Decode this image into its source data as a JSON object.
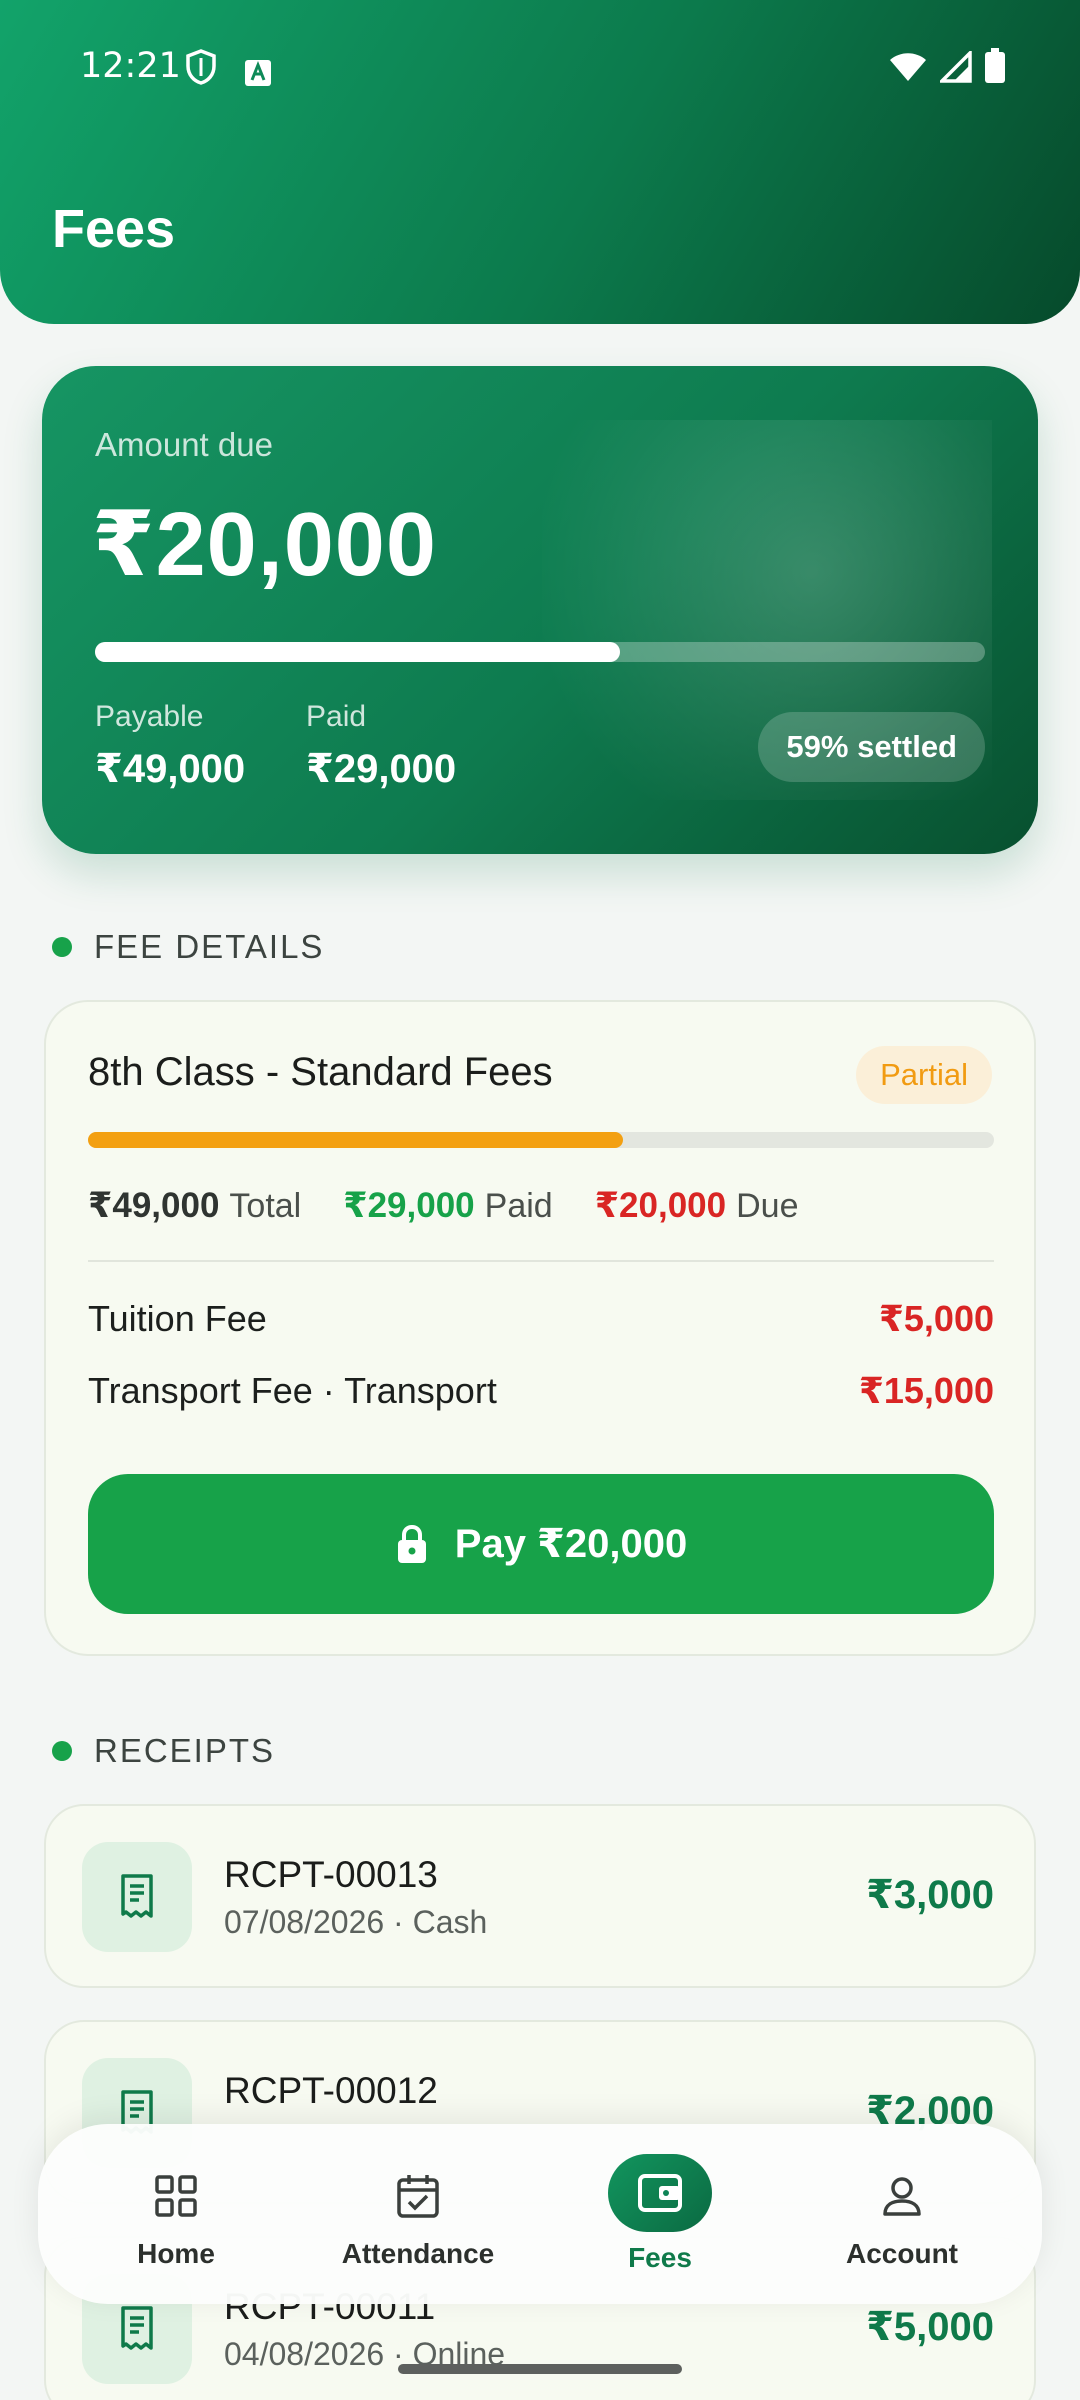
{
  "status_bar": {
    "time": "12:21"
  },
  "header": {
    "title": "Fees"
  },
  "summary": {
    "amount_label": "Amount due",
    "amount_value": "₹20,000",
    "paid_fraction": 0.59,
    "payable_label": "Payable",
    "payable_value": "₹49,000",
    "paid_label": "Paid",
    "paid_value": "₹29,000",
    "settled_text": "59% settled"
  },
  "fee_details": {
    "section_title": "FEE DETAILS",
    "class_title": "8th Class - Standard Fees",
    "status_badge": "Partial",
    "paid_fraction": 0.59,
    "total_value": "₹49,000",
    "total_label": "Total",
    "paid_value": "₹29,000",
    "paid_label": "Paid",
    "due_value": "₹20,000",
    "due_label": "Due",
    "items": [
      {
        "name": "Tuition Fee",
        "amount": "₹5,000"
      },
      {
        "name": "Transport Fee · Transport",
        "amount": "₹15,000"
      }
    ],
    "pay_label": "Pay ₹20,000"
  },
  "receipts": {
    "section_title": "RECEIPTS",
    "items": [
      {
        "number": "RCPT-00013",
        "meta": "07/08/2026 · Cash",
        "amount": "₹3,000"
      },
      {
        "number": "RCPT-00012",
        "meta": "",
        "amount": "₹2,000"
      },
      {
        "number": "RCPT-00011",
        "meta": "04/08/2026 · Online",
        "amount": "₹5,000"
      }
    ]
  },
  "nav": {
    "items": [
      {
        "label": "Home",
        "icon": "grid-icon"
      },
      {
        "label": "Attendance",
        "icon": "calendar-check-icon"
      },
      {
        "label": "Fees",
        "icon": "wallet-icon",
        "active": true
      },
      {
        "label": "Account",
        "icon": "person-icon"
      }
    ]
  },
  "colors": {
    "brand_green": "#0f7a4a",
    "pay_green": "#17a249",
    "due_red": "#d92524",
    "partial_orange": "#f3a012"
  }
}
